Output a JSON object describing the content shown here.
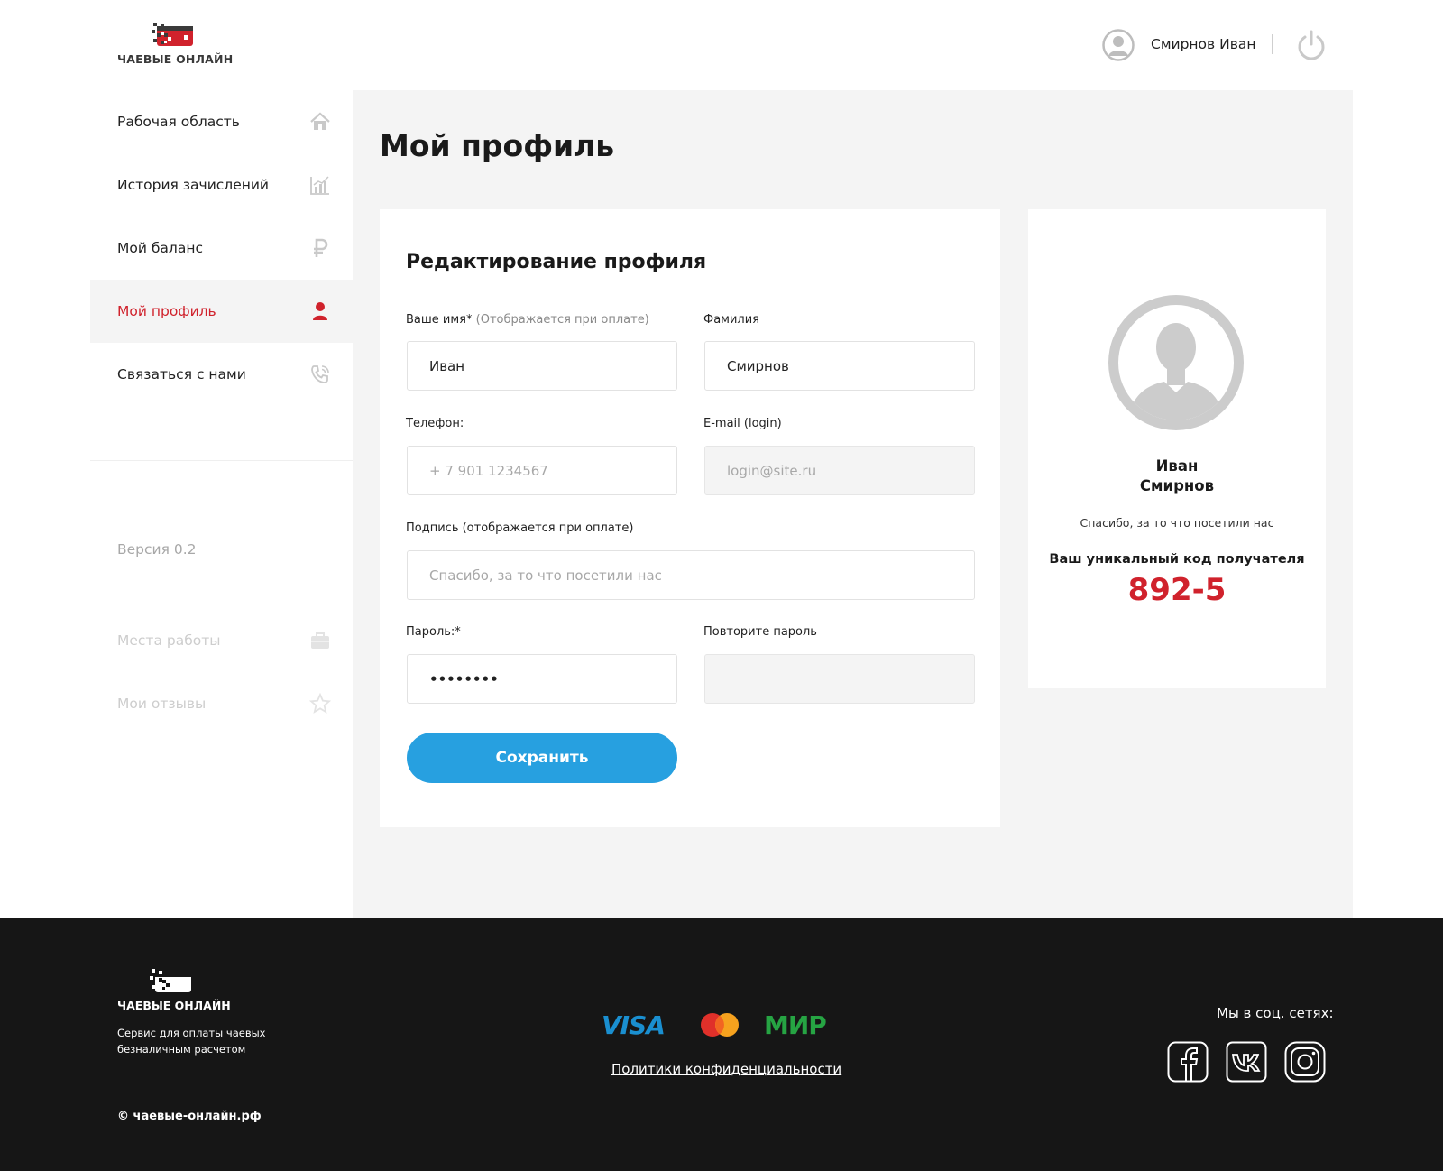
{
  "brand": {
    "name": "ЧАЕВЫЕ ОНЛАЙН",
    "accent": "#d0222c"
  },
  "header": {
    "user_name": "Смирнов Иван"
  },
  "sidebar": {
    "items": [
      {
        "label": "Рабочая область",
        "icon": "home-icon"
      },
      {
        "label": "История зачислений",
        "icon": "chart-icon"
      },
      {
        "label": "Мой баланс",
        "icon": "ruble-icon"
      },
      {
        "label": "Мой профиль",
        "icon": "user-icon",
        "active": true
      },
      {
        "label": "Связаться с нами",
        "icon": "phone-icon"
      }
    ],
    "version": "Версия 0.2",
    "extra_items": [
      {
        "label": "Места работы",
        "icon": "briefcase-icon"
      },
      {
        "label": "Мои отзывы",
        "icon": "star-icon"
      }
    ]
  },
  "main": {
    "title": "Мой профиль",
    "form": {
      "title": "Редактирование профиля",
      "first_name_label": "Ваше имя*",
      "first_name_hint": "(Отображается при оплате)",
      "first_name_value": "Иван",
      "last_name_label": "Фамилия",
      "last_name_value": "Смирнов",
      "phone_label": "Телефон:",
      "phone_placeholder": "+ 7 901 1234567",
      "email_label": "E-mail (login)",
      "email_placeholder": "login@site.ru",
      "signature_label": "Подпись (отображается при оплате)",
      "signature_placeholder": "Спасибо, за то что посетили нас",
      "password_label": "Пароль:*",
      "password_value": "12345678",
      "repeat_password_label": "Повторите пароль",
      "save_label": "Сохранить"
    },
    "profile_card": {
      "first_name": "Иван",
      "last_name": "Смирнов",
      "signature": "Спасибо, за то что посетили нас",
      "code_label": "Ваш уникальный код получателя",
      "code": "892-5"
    }
  },
  "footer": {
    "brand": "ЧАЕВЫЕ ОНЛАЙН",
    "description": "Сервис для оплаты чаевых безналичным расчетом",
    "copyright": "© чаевые-онлайн.рф",
    "payments": {
      "visa": "VISA",
      "mir": "МИР"
    },
    "privacy_link": "Политики конфиденциальности",
    "social_title": "Мы в соц. сетях:",
    "social": [
      "facebook-icon",
      "vk-icon",
      "instagram-icon"
    ]
  }
}
